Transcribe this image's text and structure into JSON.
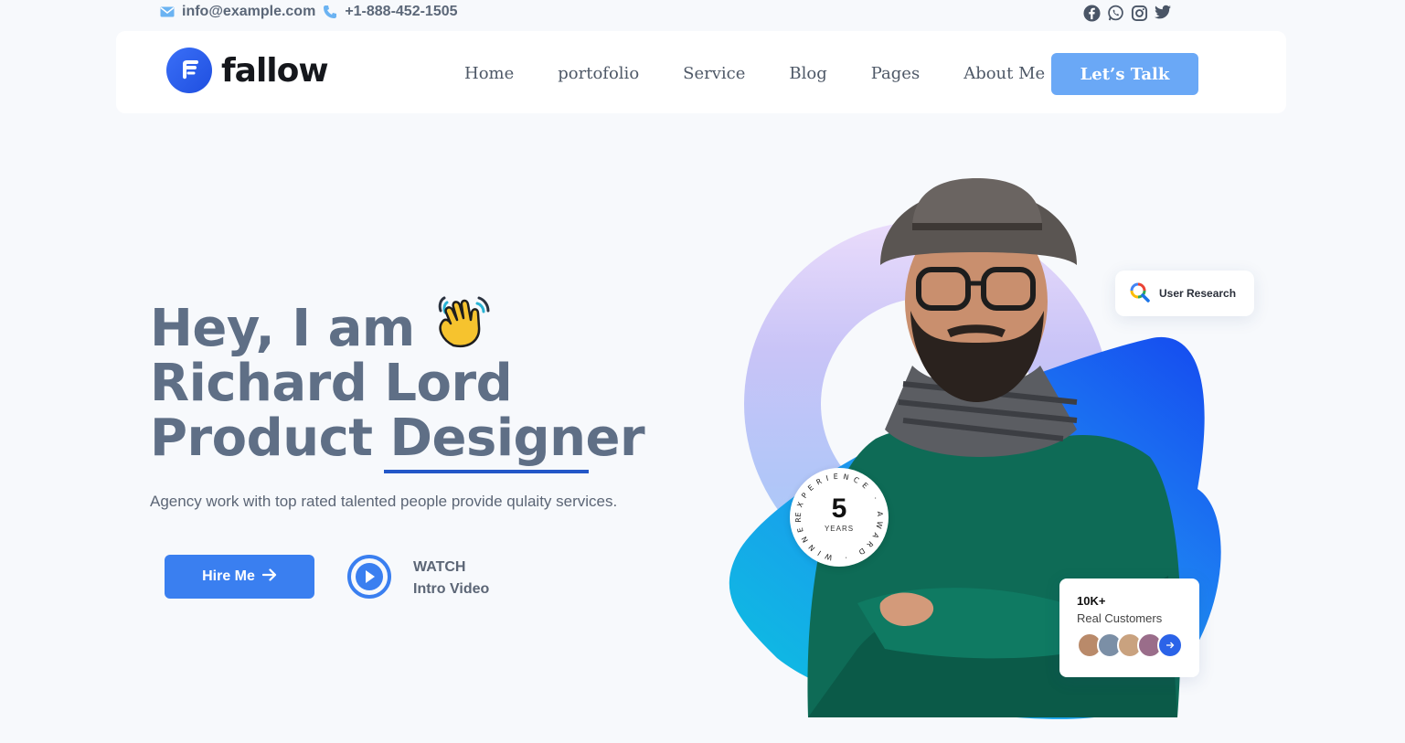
{
  "topbar": {
    "email": "info@example.com",
    "phone": "+1-888-452-1505",
    "socials": [
      "facebook-icon",
      "whatsapp-icon",
      "instagram-icon",
      "twitter-icon"
    ]
  },
  "nav": {
    "logo_text": "fallow",
    "menu": [
      "Home",
      "portofolio",
      "Service",
      "Blog",
      "Pages",
      "About Me"
    ],
    "cta": "Let’s Talk"
  },
  "hero": {
    "line1": "Hey, I am",
    "line2": "Richard Lord",
    "line3": "Product Designer",
    "tagline": "Agency work with top rated talented people provide qulaity services.",
    "hire_label": "Hire Me",
    "watch_label": "WATCH",
    "video_label": "Intro Video"
  },
  "visual": {
    "badge_number": "5",
    "badge_unit": "YEARS",
    "badge_ring_text": "EXPERIENCE · AWARD · WINNER ·",
    "research_label": "User Research",
    "customers_count": "10K+",
    "customers_label": "Real Customers"
  },
  "colors": {
    "accent": "#3a7ff0",
    "cta": "#6aa8f6",
    "heading": "#5f6f86",
    "underline": "#2357c8"
  }
}
